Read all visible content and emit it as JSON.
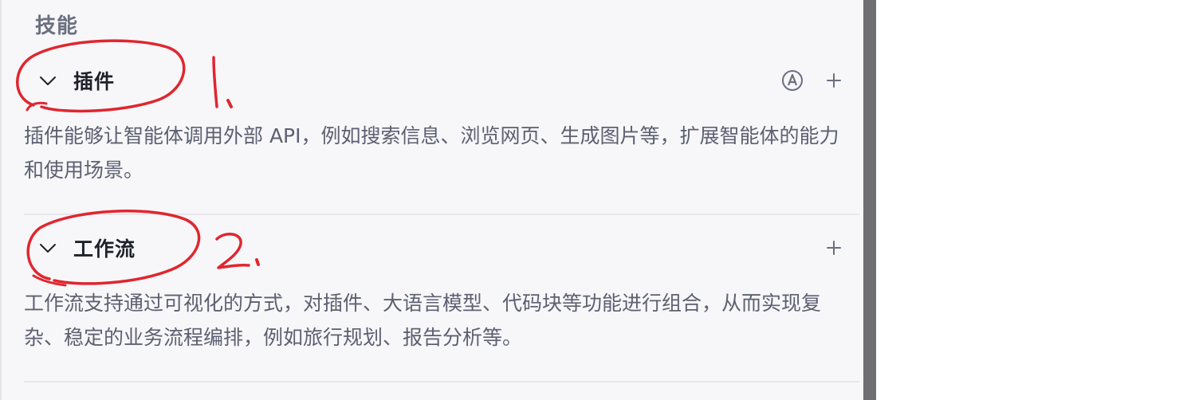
{
  "skills_panel": {
    "title": "技能",
    "plugin": {
      "label": "插件",
      "description": "插件能够让智能体调用外部 API，例如搜索信息、浏览网页、生成图片等，扩展智能体的能力和使用场景。",
      "auto_icon": "auto-mode-icon",
      "add_icon": "plus-icon"
    },
    "workflow": {
      "label": "工作流",
      "description": "工作流支持通过可视化的方式，对插件、大语言模型、代码块等功能进行组合，从而实现复杂、稳定的业务流程编排，例如旅行规划、报告分析等。",
      "add_icon": "plus-icon"
    }
  },
  "annotations": {
    "mark_1": "1.",
    "mark_2": "2.",
    "ink_color": "#e0262e"
  },
  "colors": {
    "panel_background": "#f7f7fa",
    "title_text": "#6b6f80",
    "heading_text": "#1f2129",
    "body_text": "#5d6070",
    "scrollbar": "#6e6e73"
  }
}
